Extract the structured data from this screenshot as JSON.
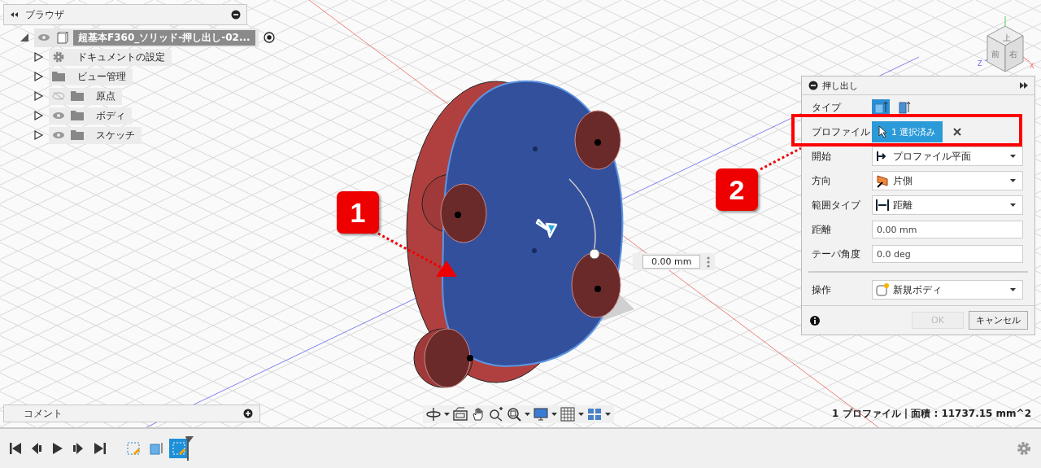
{
  "browser": {
    "title": "ブラウザ",
    "root": {
      "label": "超基本F360_ソリッド-押し出し-02...",
      "expanded": true,
      "visible": true,
      "children": [
        {
          "label": "ドキュメントの設定",
          "kind": "settings",
          "expanded": false
        },
        {
          "label": "ビュー管理",
          "kind": "folder",
          "expanded": false
        },
        {
          "label": "原点",
          "kind": "folder",
          "expanded": false,
          "visible": false
        },
        {
          "label": "ボディ",
          "kind": "folder",
          "expanded": false,
          "visible": true
        },
        {
          "label": "スケッチ",
          "kind": "folder",
          "expanded": false,
          "visible": true
        }
      ]
    }
  },
  "viewcube": {
    "faces": [
      "上",
      "前",
      "右"
    ],
    "axes": [
      "Z",
      "X"
    ]
  },
  "dimension_input": {
    "value": "0.00 mm"
  },
  "callouts": [
    {
      "label": "1"
    },
    {
      "label": "2"
    }
  ],
  "extrude_dialog": {
    "title": "押し出し",
    "rows": [
      {
        "kind": "type",
        "label": "タイプ",
        "options": [
          {
            "selected": true
          },
          {
            "selected": false
          }
        ]
      },
      {
        "kind": "selection",
        "label": "プロファイル",
        "value": "1 選択済み"
      },
      {
        "kind": "dropdown",
        "label": "開始",
        "value": "プロファイル平面"
      },
      {
        "kind": "dropdown",
        "label": "方向",
        "value": "片側"
      },
      {
        "kind": "dropdown",
        "label": "範囲タイプ",
        "value": "距離"
      },
      {
        "kind": "input",
        "label": "距離",
        "value": "0.00 mm"
      },
      {
        "kind": "input",
        "label": "テーパ角度",
        "value": "0.0 deg"
      },
      {
        "kind": "dropdown",
        "label": "操作",
        "value": "新規ボディ",
        "separated": true
      }
    ],
    "buttons": [
      {
        "label": "OK",
        "disabled": true
      },
      {
        "label": "キャンセル",
        "disabled": false
      }
    ]
  },
  "comments": {
    "title": "コメント"
  },
  "status": "1 プロファイル | 面積 : 11737.15 mm^2",
  "timeline": {
    "features": [
      {
        "kind": "sketch",
        "selected": false
      },
      {
        "kind": "extrude",
        "selected": false
      },
      {
        "kind": "sketch",
        "selected": true
      }
    ]
  }
}
